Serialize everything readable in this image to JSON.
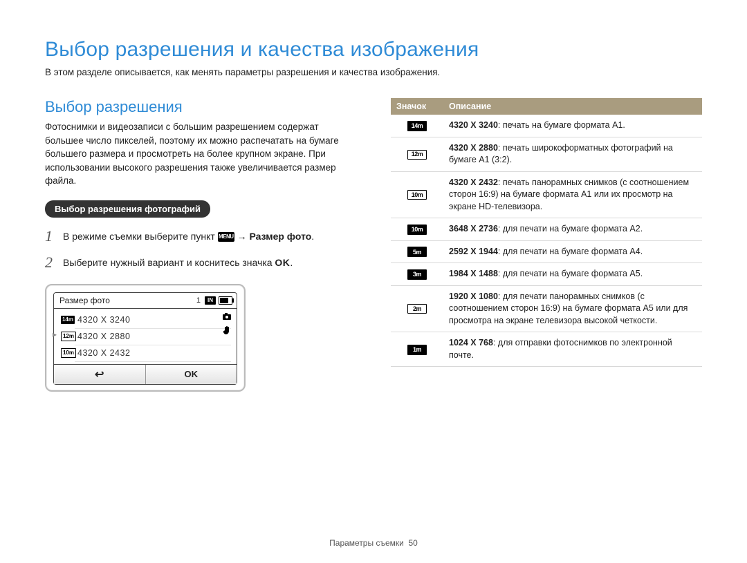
{
  "page_title": "Выбор разрешения и качества изображения",
  "page_subtitle": "В этом разделе описывается, как менять параметры разрешения и качества изображения.",
  "footer": {
    "section": "Параметры съемки",
    "page": "50"
  },
  "left": {
    "section_title": "Выбор разрешения",
    "body_text": "Фотоснимки и видеозаписи с большим разрешением содержат большее число пикселей, поэтому их можно распечатать на бумаге большего размера и просмотреть на более крупном экране. При использовании высокого разрешения также увеличивается размер файла.",
    "pill": "Выбор разрешения фотографий",
    "steps": [
      {
        "num": "1",
        "prefix": "В режиме съемки выберите пункт ",
        "menu_chip": "MENU",
        "arrow": "→",
        "bold_tail": "Размер фото",
        "tail_dot": "."
      },
      {
        "num": "2",
        "prefix": "Выберите нужный вариант и коснитесь значка ",
        "ok_chip": "OK",
        "tail_dot": "."
      }
    ],
    "device": {
      "title": "Размер фото",
      "hdr_num": "1",
      "hdr_in": "IN",
      "rows": [
        {
          "tag": "14m",
          "tag_style": "filled",
          "value": "4320 X 3240"
        },
        {
          "tag": "12m",
          "tag_style": "outline",
          "value": "4320 X 2880",
          "selected": true
        },
        {
          "tag": "10m",
          "tag_style": "outline",
          "value": "4320 X 2432"
        }
      ],
      "back": "↩",
      "ok": "OK"
    }
  },
  "table": {
    "headers": {
      "icon": "Значок",
      "desc": "Описание"
    },
    "rows": [
      {
        "icon_text": "14m",
        "icon_style": "filled",
        "bold": "4320 X 3240",
        "desc": ": печать на бумаге формата A1."
      },
      {
        "icon_text": "12m",
        "icon_style": "outline",
        "bold": "4320 X 2880",
        "desc": ": печать широкоформатных фотографий на бумаге A1 (3:2)."
      },
      {
        "icon_text": "10m",
        "icon_style": "outline",
        "bold": "4320 X 2432",
        "desc": ": печать панорамных снимков (с соотношением сторон 16:9) на бумаге формата A1 или их просмотр на экране HD-телевизора."
      },
      {
        "icon_text": "10m",
        "icon_style": "filled",
        "bold": "3648 X 2736",
        "desc": ": для печати на бумаге формата A2."
      },
      {
        "icon_text": "5m",
        "icon_style": "filled",
        "bold": "2592 X 1944",
        "desc": ": для печати на бумаге формата A4."
      },
      {
        "icon_text": "3m",
        "icon_style": "filled",
        "bold": "1984 X 1488",
        "desc": ": для печати на бумаге формата A5."
      },
      {
        "icon_text": "2m",
        "icon_style": "outline",
        "bold": "1920 X 1080",
        "desc": ": для печати панорамных снимков (с соотношением сторон 16:9) на бумаге формата A5 или для просмотра на экране телевизора высокой четкости."
      },
      {
        "icon_text": "1m",
        "icon_style": "filled",
        "bold": "1024 X 768",
        "desc": ": для отправки фотоснимков по электронной почте."
      }
    ]
  }
}
